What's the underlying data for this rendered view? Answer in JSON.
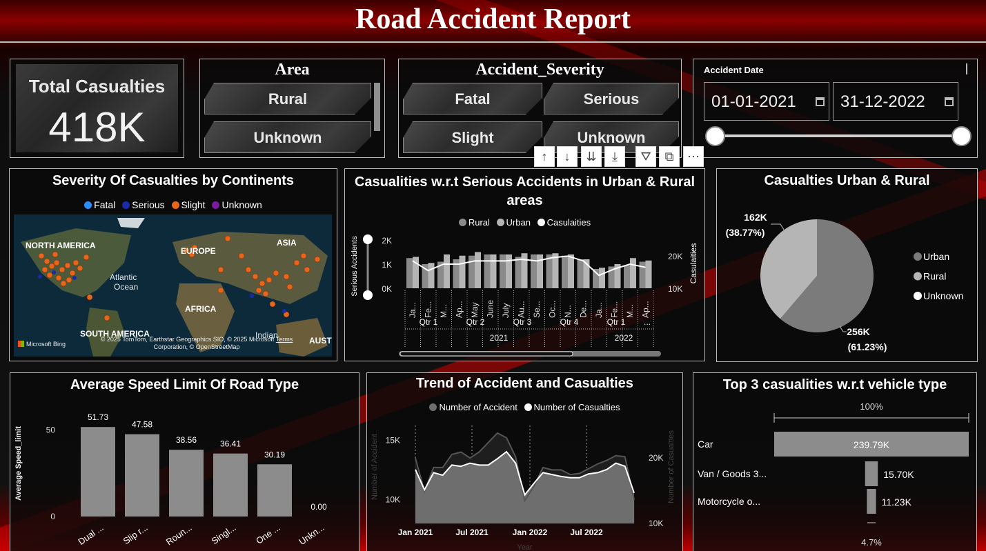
{
  "title": "Road Accident Report",
  "kpi": {
    "label": "Total Casualties",
    "value": "418K"
  },
  "area_slicer": {
    "title": "Area",
    "options": [
      "Rural",
      "Unknown"
    ]
  },
  "severity_slicer": {
    "title": "Accident_Severity",
    "options": [
      "Fatal",
      "Serious",
      "Slight",
      "Unknown"
    ]
  },
  "date_slicer": {
    "label": "Accident Date",
    "start": "01-01-2021",
    "end": "31-12-2022"
  },
  "visual_toolbar": {
    "icons": [
      "arrow-up-icon",
      "arrow-down-icon",
      "double-arrow-down-icon",
      "expand-hierarchy-icon",
      "filter-icon",
      "focus-mode-icon",
      "more-options-icon"
    ]
  },
  "map_panel": {
    "title": "Severity Of Casualties by Continents",
    "legend": [
      {
        "label": "Fatal",
        "color": "#2f8cff"
      },
      {
        "label": "Serious",
        "color": "#1a2aa8"
      },
      {
        "label": "Slight",
        "color": "#e8661c"
      },
      {
        "label": "Unknown",
        "color": "#7a1a9c"
      }
    ],
    "labels": {
      "north_america": "NORTH AMERICA",
      "europe": "EUROPE",
      "asia": "ASIA",
      "atlantic": "Atlantic",
      "ocean": "Ocean",
      "africa": "AFRICA",
      "south_america": "SOUTH AMERICA",
      "indian": "Indian",
      "austr": "AUSTR"
    },
    "attribution_line1": "© 2025 TomTom, Earthstar Geographics SIO, © 2025 Microsoft",
    "attribution_terms": "Terms",
    "attribution_line2": "Corporation, © OpenStreetMap",
    "brand": "Microsoft Bing"
  },
  "serious_panel": {
    "title_line1": "Casualities w.r.t Serious Accidents in Urban & Rural",
    "title_line2": "areas",
    "legend": [
      {
        "label": "Rural",
        "color": "#8a8a8a"
      },
      {
        "label": "Urban",
        "color": "#b5b5b5"
      },
      {
        "label": "Casulaities",
        "color": "#ffffff"
      }
    ],
    "y_left_label": "Serious Accidents",
    "y_right_label": "Casulaities"
  },
  "chart_data": [
    {
      "type": "bar",
      "title": "Casualities w.r.t Serious Accidents in Urban & Rural areas",
      "categories": [
        "Ja...",
        "Fe...",
        "M...",
        "Ap...",
        "May",
        "June",
        "July",
        "Au...",
        "Se...",
        "Oc...",
        "N...",
        "De...",
        "Ja...",
        "Fe...",
        "M...",
        "Ap..."
      ],
      "quarters": [
        {
          "label": "Qtr 1",
          "year": "2021"
        },
        {
          "label": "Qtr 2",
          "year": "2021"
        },
        {
          "label": "Qtr 3",
          "year": "2021"
        },
        {
          "label": "Qtr 4",
          "year": "2021"
        },
        {
          "label": "Qtr 1",
          "year": "2022"
        },
        {
          "label": "...",
          "year": "2022"
        }
      ],
      "years": [
        "2021",
        "2022"
      ],
      "series": [
        {
          "name": "Rural",
          "values": [
            1250,
            1000,
            1100,
            1200,
            1350,
            1400,
            1400,
            1300,
            1400,
            1400,
            1350,
            1200,
            800,
            900,
            950,
            1100
          ]
        },
        {
          "name": "Urban",
          "values": [
            1300,
            1050,
            1400,
            1350,
            1500,
            1400,
            1400,
            1450,
            1400,
            1450,
            1400,
            1200,
            850,
            1000,
            1250,
            1150
          ]
        },
        {
          "name": "Casulaities",
          "axis": "right",
          "values": [
            18500,
            15500,
            17500,
            17500,
            18500,
            18500,
            18500,
            19000,
            18500,
            19500,
            20000,
            18500,
            14000,
            16000,
            17500,
            16500
          ]
        }
      ],
      "y_left_ticks": [
        "2K",
        "1K",
        "0K"
      ],
      "y_left_range": [
        0,
        2000
      ],
      "y_right_ticks": [
        "20K",
        "10K"
      ],
      "y_right_range": [
        10000,
        25000
      ],
      "ylabel_left": "Serious Accidents",
      "ylabel_right": "Casulaities"
    },
    {
      "type": "pie",
      "title": "Casualties Urban & Rural",
      "slices": [
        {
          "label": "Urban",
          "value": 256,
          "display": "256K",
          "pct": "(61.23%)",
          "color": "#7b7b7b"
        },
        {
          "label": "Rural",
          "value": 162,
          "display": "162K",
          "pct": "(38.77%)",
          "color": "#b5b5b5"
        },
        {
          "label": "Unknown",
          "value": 0,
          "display": "",
          "pct": "",
          "color": "#ffffff"
        }
      ],
      "legend_placement": "right"
    },
    {
      "type": "bar",
      "title": "Average Speed Limit Of Road Type",
      "categories": [
        "Dual ...",
        "Slip r...",
        "Roun...",
        "Singl...",
        "One ...",
        "Unkn..."
      ],
      "values": [
        51.73,
        47.58,
        38.56,
        36.41,
        30.19,
        0.0
      ],
      "labels": [
        "51.73",
        "47.58",
        "38.56",
        "36.41",
        "30.19",
        "0.00"
      ],
      "ylabel": "Average Speed_limit",
      "y_ticks": [
        "50",
        "0"
      ],
      "ylim": [
        0,
        55
      ],
      "color": "#8c8c8c"
    },
    {
      "type": "area",
      "title": "Trend of Accident and Casualties",
      "x_ticks": [
        "Jan 2021",
        "Jul 2021",
        "Jan 2022",
        "Jul 2022"
      ],
      "series": [
        {
          "name": "Number of Accident",
          "color": "#6e6e6e",
          "values": [
            13500,
            10700,
            12700,
            12700,
            13800,
            14000,
            13500,
            14000,
            14800,
            15600,
            15200,
            13600,
            9900,
            11100,
            12700,
            12500,
            12500,
            12100,
            12200,
            12600,
            13000,
            13300,
            13700,
            13600,
            10000
          ]
        },
        {
          "name": "Number of Casualties",
          "color": "#ffffff",
          "values": [
            18500,
            15300,
            18000,
            17600,
            19200,
            19000,
            19500,
            19200,
            19200,
            20200,
            21300,
            19500,
            14500,
            16300,
            18000,
            17700,
            17400,
            17200,
            17200,
            17800,
            18000,
            18500,
            19500,
            19000,
            14800
          ]
        }
      ],
      "y_left_ticks": [
        "15K",
        "10K"
      ],
      "y_left_range": [
        8000,
        16000
      ],
      "y_right_ticks": [
        "20K",
        "10K"
      ],
      "y_right_range": [
        10000,
        25000
      ],
      "ylabel_left": "Number of Accident",
      "ylabel_right": "Number of Casualties",
      "xlabel": "Year"
    },
    {
      "type": "bar",
      "orientation": "horizontal",
      "title": "Top 3 casualities w.r.t vehicle type",
      "categories": [
        "Car",
        "Van / Goods 3...",
        "Motorcycle o..."
      ],
      "values": [
        239.79,
        15.7,
        11.23
      ],
      "labels": [
        "239.79K",
        "15.70K",
        "11.23K"
      ],
      "top_label": "100%",
      "bottom_label": "4.7%",
      "color": "#8c8c8c"
    }
  ]
}
